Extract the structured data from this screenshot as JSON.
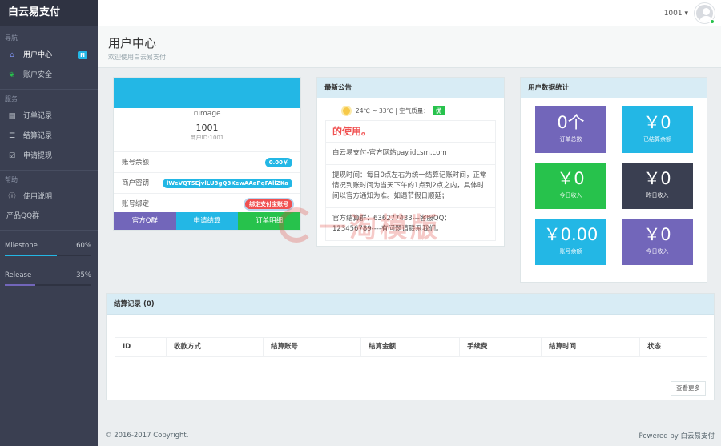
{
  "brand": "白云易支付",
  "sidebar": {
    "sections": [
      "导航",
      "服务",
      "帮助"
    ],
    "nav": [
      {
        "label": "用户中心",
        "icon": "home-icon",
        "badge": "N"
      },
      {
        "label": "账户安全",
        "icon": "leaf-icon"
      },
      {
        "label": "订单记录",
        "icon": "list-alt-icon"
      },
      {
        "label": "结算记录",
        "icon": "list-icon"
      },
      {
        "label": "申请提现",
        "icon": "check-square-icon"
      },
      {
        "label": "使用说明",
        "icon": "info-circle-icon"
      },
      {
        "label": "产品QQ群"
      }
    ],
    "progress": [
      {
        "label": "Milestone",
        "value": "60%",
        "fraction": 0.6
      },
      {
        "label": "Release",
        "value": "35%",
        "fraction": 0.35
      }
    ]
  },
  "header": {
    "user": "1001 ▾"
  },
  "page": {
    "title": "用户中心",
    "subtitle": "欢迎使用白云易支付"
  },
  "account": {
    "image_alt": "image",
    "name": "1001",
    "merchant_id": "商户ID:1001",
    "rows": [
      {
        "label": "账号余额",
        "value": "0.00￥"
      },
      {
        "label": "商户密钥",
        "value": "lWeVQT5EjvlLU3gQ3KewAAaPqFAllZKa"
      },
      {
        "label": "账号绑定",
        "value": "绑定支付宝账号"
      }
    ],
    "buttons": [
      "官方Q群",
      "申请结算",
      "订单明细"
    ]
  },
  "notice": {
    "title": "最新公告",
    "weather": "24℃ ~ 33℃ | 空气质量：",
    "air_quality": "优",
    "headline": "的使用。",
    "lines": [
      "白云易支付-官方网站pay.idcsm.com",
      "提现时间：每日0点左右为统一结算记账时间，正常情况到账时间为当天下午的1点到2点之内，具体时间以官方通知为准。如遇节假日顺延；",
      "官方结算群：636277433---客服QQ：123456789----有问题请联系我们。"
    ]
  },
  "stats": {
    "title": "用户数据统计",
    "tiles": [
      {
        "value": "0个",
        "label": "订单总数",
        "color": "#7266ba"
      },
      {
        "value": "￥0",
        "label": "已结算余额",
        "color": "#23b7e5"
      },
      {
        "value": "￥0",
        "label": "今日收入",
        "color": "#27c24c"
      },
      {
        "value": "￥0",
        "label": "昨日收入",
        "color": "#3a3f51"
      },
      {
        "value": "￥0.00",
        "label": "账号余额",
        "color": "#23b7e5"
      },
      {
        "value": "￥0",
        "label": "今日收入",
        "color": "#7266ba"
      }
    ]
  },
  "records": {
    "title": "结算记录 (0)",
    "columns": [
      "ID",
      "收款方式",
      "结算账号",
      "结算金额",
      "手续费",
      "结算时间",
      "状态"
    ],
    "more": "查看更多"
  },
  "watermark": "一淘模版",
  "footer": {
    "copyright": "© 2016-2017 Copyright.",
    "powered": "Powered by 白云易支付"
  }
}
